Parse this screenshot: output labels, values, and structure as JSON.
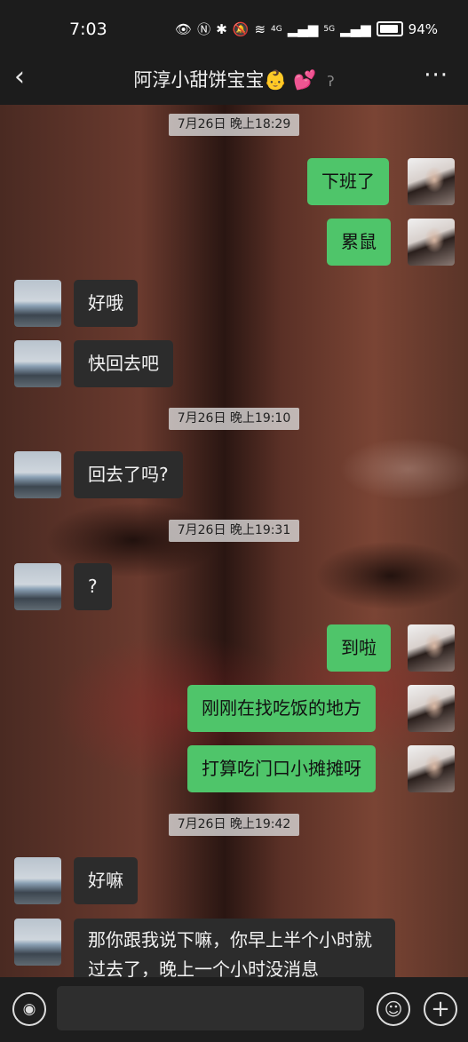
{
  "status_bar": {
    "time": "7:03",
    "signal_4g": "4G",
    "signal_5g": "5G",
    "battery": "94%"
  },
  "header": {
    "back_icon": "chevron-left-icon",
    "title": "阿淳小甜饼宝宝👶 💕",
    "ear_icon": "ear-icon",
    "more_icon": "more-icon"
  },
  "timestamps": [
    "7月26日 晚上18:29",
    "7月26日 晚上19:10",
    "7月26日 晚上19:31",
    "7月26日 晚上19:42"
  ],
  "messages": [
    {
      "side": "out",
      "text": "下班了"
    },
    {
      "side": "out",
      "text": "累鼠"
    },
    {
      "side": "in",
      "text": "好哦"
    },
    {
      "side": "in",
      "text": "快回去吧"
    },
    {
      "side": "in",
      "text": "回去了吗?"
    },
    {
      "side": "in",
      "text": "?"
    },
    {
      "side": "out",
      "text": "到啦"
    },
    {
      "side": "out",
      "text": "刚刚在找吃饭的地方"
    },
    {
      "side": "out",
      "text": "打算吃门口小摊摊呀"
    },
    {
      "side": "in",
      "text": "好嘛"
    },
    {
      "side": "in",
      "text": "那你跟我说下嘛，你早上半个小时就过去了，晚上一个小时没消息"
    }
  ],
  "input_bar": {
    "voice_icon": "voice-icon",
    "emoji_icon": "emoji-icon",
    "plus_icon": "plus-icon"
  },
  "colors": {
    "outgoing_bubble": "#4fc56a",
    "incoming_bubble": "#2c2c2c",
    "bar_background": "#1c1c1c"
  }
}
